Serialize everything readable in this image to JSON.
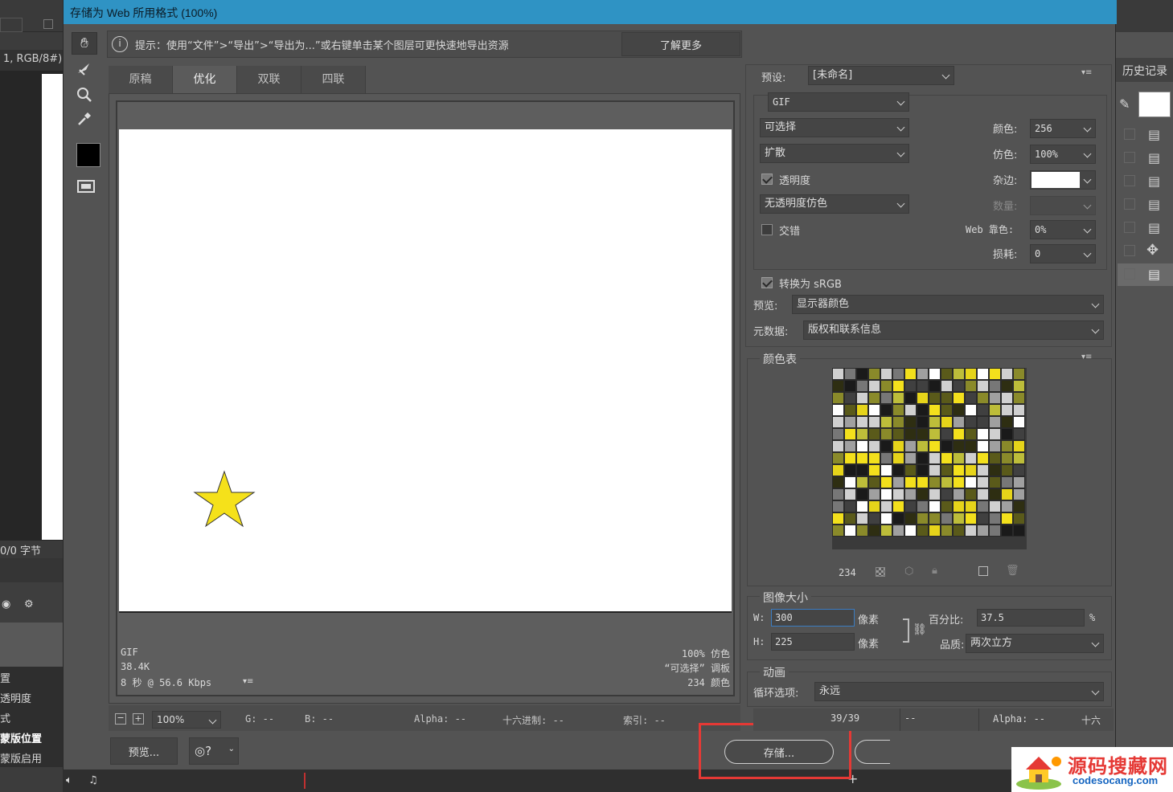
{
  "background": {
    "doc_tab_fragment": "1, RGB/8#)",
    "bytes_label": "0/0 字节",
    "layer_items": [
      "置",
      "透明度",
      "式",
      "蒙版位置",
      "蒙版启用"
    ],
    "history_title": "历史记录"
  },
  "dialog": {
    "title": "存储为 Web 所用格式 (100%)",
    "hint_text": "提示：使用“文件”>“导出”>“导出为...”或右键单击某个图层可更快速地导出资源",
    "learn_more": "了解更多",
    "tabs": [
      "原稿",
      "优化",
      "双联",
      "四联"
    ],
    "active_tab": 1,
    "preview_info": {
      "format": "GIF",
      "size": "38.4K",
      "speed": "8 秒 @ 56.6 Kbps",
      "dither": "100% 仿色",
      "palette": "“可选择” 调板",
      "colors": "234 颜色"
    },
    "zoom": "100%",
    "readout": {
      "g": "G: --",
      "b": "B: --",
      "alpha": "Alpha: --",
      "hex": "十六进制: --",
      "index": "索引: --"
    },
    "buttons": {
      "preview": "预览...",
      "save": "存储..."
    },
    "settings": {
      "preset_label": "预设:",
      "preset_value": "[未命名]",
      "format": "GIF",
      "reduction": "可选择",
      "dither_algo": "扩散",
      "transparency_label": "透明度",
      "transparency_checked": true,
      "matte_dither": "无透明度仿色",
      "interlaced_label": "交错",
      "interlaced_checked": false,
      "colors_label": "颜色:",
      "colors_value": "256",
      "dither_label": "仿色:",
      "dither_value": "100%",
      "matte_label": "杂边:",
      "amount_label": "数量:",
      "web_snap_label": "Web 靠色:",
      "web_snap_value": "0%",
      "lossy_label": "损耗:",
      "lossy_value": "0",
      "convert_srgb_label": "转换为 sRGB",
      "convert_srgb_checked": true,
      "preview_label": "预览:",
      "preview_value": "显示器颜色",
      "metadata_label": "元数据:",
      "metadata_value": "版权和联系信息"
    },
    "color_table": {
      "title": "颜色表",
      "count": "234"
    },
    "image_size": {
      "title": "图像大小",
      "w_label": "W:",
      "w_value": "300",
      "h_label": "H:",
      "h_value": "225",
      "unit": "像素",
      "percent_label": "百分比:",
      "percent_value": "37.5",
      "percent_unit": "%",
      "quality_label": "品质:",
      "quality_value": "两次立方"
    },
    "animation": {
      "title": "动画",
      "loop_label": "循环选项:",
      "loop_value": "永远",
      "frame_counter": "39/39"
    },
    "bottom_readout": {
      "alpha": "Alpha: --",
      "hex": "十六"
    }
  },
  "watermark": {
    "cn": "源码搜藏网",
    "url": "codesocang.com"
  },
  "colors": {
    "title_bar": "#2f93c4",
    "highlight_box": "#e53935",
    "star": "#f5e11a"
  }
}
